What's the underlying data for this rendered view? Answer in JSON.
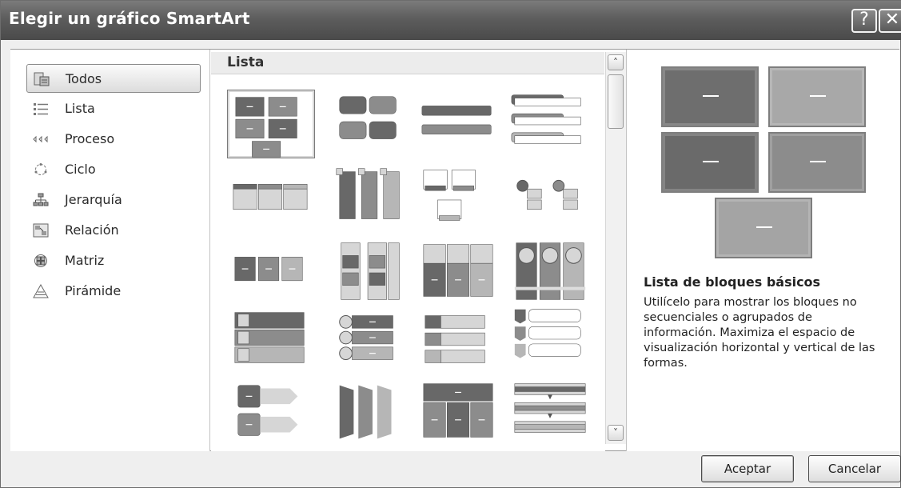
{
  "window": {
    "title": "Elegir un gráfico SmartArt",
    "help_glyph": "?",
    "close_glyph": "✕"
  },
  "sidebar": {
    "items": [
      {
        "label": "Todos",
        "icon": "all-icon",
        "selected": true
      },
      {
        "label": "Lista",
        "icon": "list-icon"
      },
      {
        "label": "Proceso",
        "icon": "process-icon"
      },
      {
        "label": "Ciclo",
        "icon": "cycle-icon"
      },
      {
        "label": "Jerarquía",
        "icon": "hierarchy-icon"
      },
      {
        "label": "Relación",
        "icon": "relationship-icon"
      },
      {
        "label": "Matriz",
        "icon": "matrix-icon"
      },
      {
        "label": "Pirámide",
        "icon": "pyramid-icon"
      }
    ]
  },
  "gallery": {
    "header": "Lista",
    "selected_index": 0,
    "items": [
      "basic-block-list",
      "lined-list",
      "vertical-bullet-list",
      "stacked-list",
      "horizontal-bullet-list",
      "vertical-box-list",
      "picture-caption-list",
      "circle-list",
      "step-list",
      "grouped-list",
      "table-list",
      "horizontal-picture-list",
      "vertical-block-list",
      "target-list",
      "trapezoid-list",
      "vertical-chevron-list",
      "vertical-arrow-list",
      "pyramid-list",
      "table-hierarchy",
      "process-list"
    ]
  },
  "scrollbar": {
    "up_glyph": "˄",
    "down_glyph": "˅"
  },
  "preview": {
    "title": "Lista de bloques básicos",
    "description": "Utilícelo para mostrar los bloques no secuenciales o agrupados de información. Maximiza el espacio de visualización horizontal y vertical de las formas."
  },
  "buttons": {
    "ok": "Aceptar",
    "cancel": "Cancelar"
  },
  "colors": {
    "title_bar": "#5d5d5d",
    "block_dark": "#6b6b6b",
    "block_light": "#a4a4a4"
  }
}
